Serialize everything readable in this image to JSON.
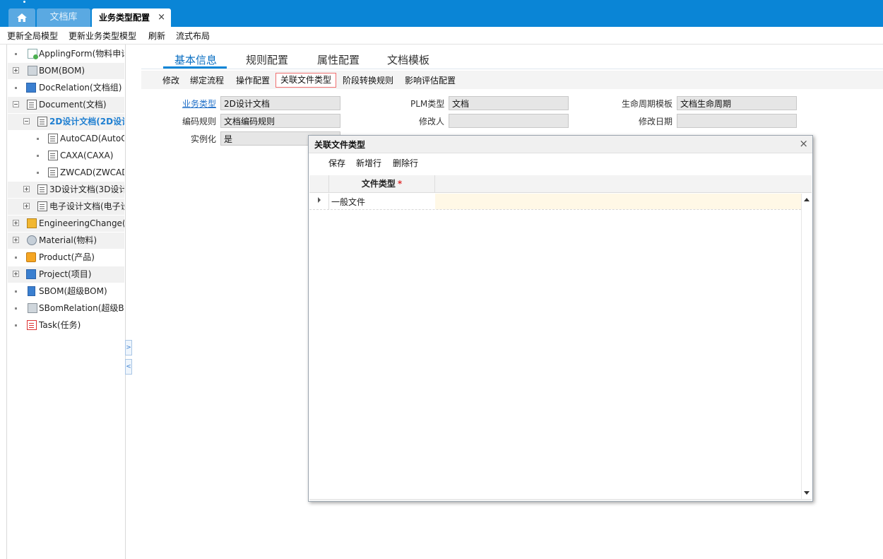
{
  "top_tabs": {
    "home_icon": "home-icon",
    "library": "文档库",
    "active": "业务类型配置",
    "close": "×"
  },
  "menu": [
    "更新全局模型",
    "更新业务类型模型",
    "刷新",
    "流式布局"
  ],
  "tree": [
    {
      "label": "ApplingForm(物料申请",
      "icon": "form-icon"
    },
    {
      "label": "BOM(BOM)",
      "icon": "bom-icon"
    },
    {
      "label": "DocRelation(文档组)",
      "icon": "docgroup-icon"
    },
    {
      "label": "Document(文档)",
      "icon": "document-icon"
    },
    {
      "label": "2D设计文档(2D设计",
      "icon": "document-icon"
    },
    {
      "label": "AutoCAD(AutoCA",
      "icon": "document-icon"
    },
    {
      "label": "CAXA(CAXA)",
      "icon": "document-icon"
    },
    {
      "label": "ZWCAD(ZWCAD",
      "icon": "document-icon"
    },
    {
      "label": "3D设计文档(3D设计",
      "icon": "document-icon"
    },
    {
      "label": "电子设计文档(电子设",
      "icon": "document-icon"
    },
    {
      "label": "EngineeringChange(变",
      "icon": "change-icon"
    },
    {
      "label": "Material(物料)",
      "icon": "gear-icon"
    },
    {
      "label": "Product(产品)",
      "icon": "product-icon"
    },
    {
      "label": "Project(项目)",
      "icon": "project-icon"
    },
    {
      "label": "SBOM(超级BOM)",
      "icon": "sbom-icon"
    },
    {
      "label": "SBomRelation(超级BO",
      "icon": "sbomrelation-icon"
    },
    {
      "label": "Task(任务)",
      "icon": "task-icon"
    }
  ],
  "main_tabs": [
    "基本信息",
    "规则配置",
    "属性配置",
    "文档模板"
  ],
  "toolbar": [
    "修改",
    "绑定流程",
    "操作配置",
    "关联文件类型",
    "阶段转换规则",
    "影响评估配置"
  ],
  "form": {
    "business_type_label": "业务类型",
    "business_type_value": "2D设计文档",
    "plm_type_label": "PLM类型",
    "plm_type_value": "文档",
    "lifecycle_label": "生命周期模板",
    "lifecycle_value": "文档生命周期",
    "coding_rule_label": "编码规则",
    "coding_rule_value": "文档编码规则",
    "modifier_label": "修改人",
    "modifier_value": "",
    "modify_date_label": "修改日期",
    "modify_date_value": "",
    "instantiate_label": "实例化",
    "instantiate_value": "是"
  },
  "dialog": {
    "title": "关联文件类型",
    "close": "×",
    "actions": [
      "保存",
      "新增行",
      "删除行"
    ],
    "column_header": "文件类型",
    "required_mark": "*",
    "rows": [
      "一般文件"
    ]
  },
  "colors": {
    "topbar": "#0a85d6",
    "accent": "#0a6fc2",
    "highlight_border": "#f07070",
    "row_fill": "#fff8e6"
  }
}
